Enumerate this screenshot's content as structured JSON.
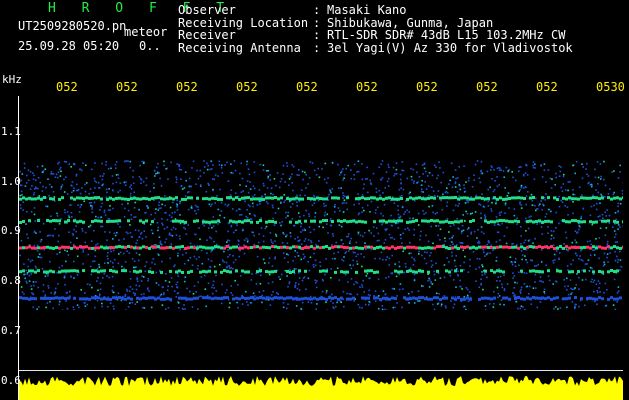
{
  "header": {
    "brand": "H R O F F T",
    "filename": "UT2509280520.pn",
    "meteor_label": "meteor",
    "datetime": "25.09.28 05:20",
    "count": "0.."
  },
  "info": {
    "rows": [
      {
        "key": "Observer",
        "value": "Masaki Kano"
      },
      {
        "key": "Receiving Location",
        "value": "Shibukawa, Gunma, Japan"
      },
      {
        "key": "Receiver",
        "value": "RTL-SDR SDR# 43dB L15 103.2MHz CW"
      },
      {
        "key": "Receiving Antenna",
        "value": "3el Yagi(V) Az 330 for Vladivostok"
      }
    ],
    "separator": ":"
  },
  "axes": {
    "freq_unit": "kHz",
    "freq_labels": [
      "1.1",
      "1.0",
      "0.9",
      "0.8",
      "0.7",
      "0.6"
    ],
    "time_labels": [
      "052",
      "052",
      "052",
      "052",
      "052",
      "052",
      "052",
      "052",
      "052",
      "0530"
    ]
  },
  "colors": {
    "background": "#000000",
    "brand": "#22ee44",
    "time_labels": "#ffee00",
    "power_trace": "#ffff00",
    "band_strong": "#ff3366",
    "band_mid": "#22dd88",
    "noise": "#1e4fd8"
  }
}
